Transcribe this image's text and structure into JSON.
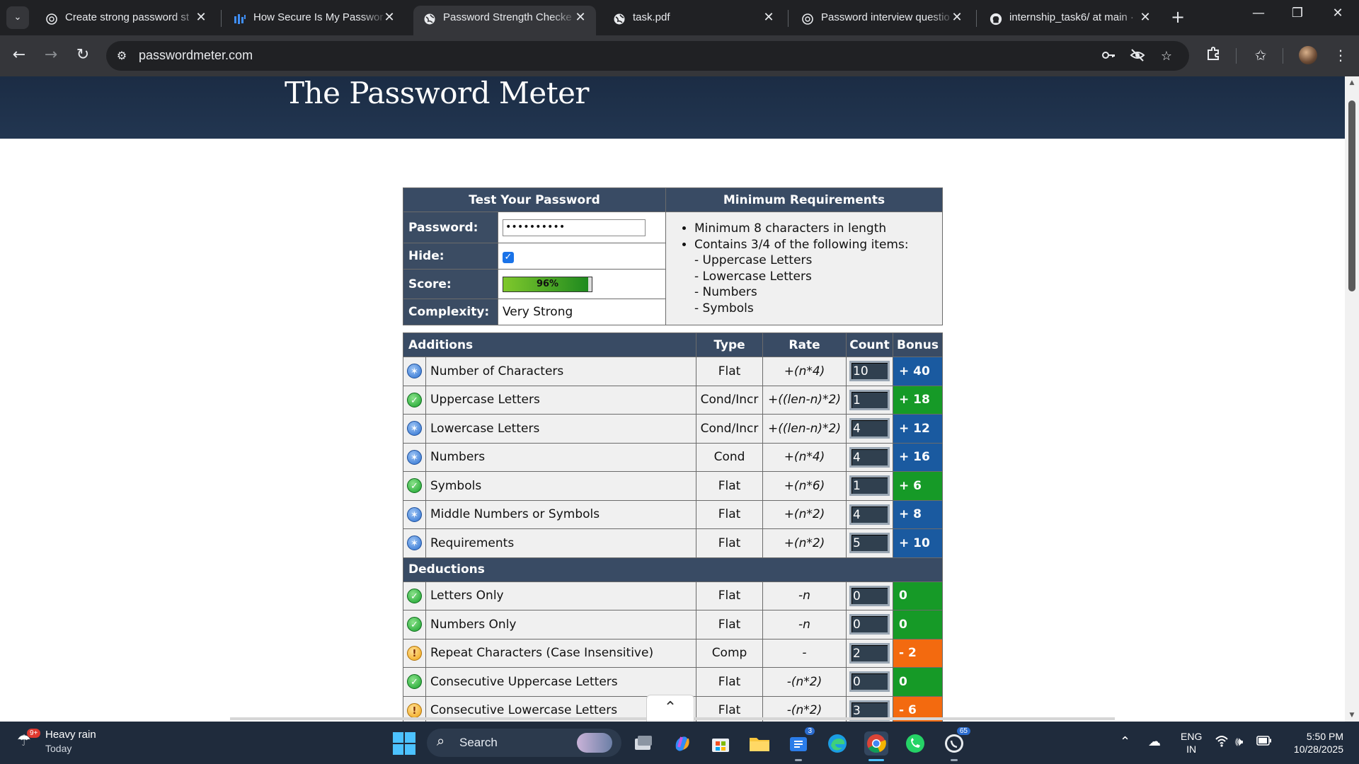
{
  "tabs": [
    {
      "title": "Create strong password st",
      "icon": "openai-icon"
    },
    {
      "title": "How Secure Is My Passwor",
      "icon": "security-org-icon"
    },
    {
      "title": "Password Strength Checke",
      "icon": "globe-icon",
      "active": true
    },
    {
      "title": "task.pdf",
      "icon": "globe-icon"
    },
    {
      "title": "Password interview questio",
      "icon": "openai-icon"
    },
    {
      "title": "internship_task6/ at main ·",
      "icon": "github-icon"
    }
  ],
  "address": {
    "url": "passwordmeter.com"
  },
  "site": {
    "title": "The Password Meter"
  },
  "meter": {
    "test_heading": "Test Your Password",
    "req_heading": "Minimum Requirements",
    "password_label": "Password:",
    "password_value": "••••••••••",
    "hide_label": "Hide:",
    "hide_checked": true,
    "score_label": "Score:",
    "score_value": "96%",
    "score_fraction": 0.96,
    "complexity_label": "Complexity:",
    "complexity_value": "Very Strong",
    "requirements": [
      "Minimum 8 characters in length",
      "Contains 3/4 of the following items:"
    ],
    "requirement_items": [
      "- Uppercase Letters",
      "- Lowercase Letters",
      "- Numbers",
      "- Symbols"
    ]
  },
  "table": {
    "headers": {
      "additions": "Additions",
      "type": "Type",
      "rate": "Rate",
      "count": "Count",
      "bonus": "Bonus",
      "deductions": "Deductions"
    },
    "additions": [
      {
        "name": "Number of Characters",
        "type": "Flat",
        "rate": "+(n*4)",
        "count": "10",
        "bonus": "+ 40",
        "status": "sufficient",
        "color": "blue"
      },
      {
        "name": "Uppercase Letters",
        "type": "Cond/Incr",
        "rate": "+((len-n)*2)",
        "count": "1",
        "bonus": "+ 18",
        "status": "good",
        "color": "green"
      },
      {
        "name": "Lowercase Letters",
        "type": "Cond/Incr",
        "rate": "+((len-n)*2)",
        "count": "4",
        "bonus": "+ 12",
        "status": "sufficient",
        "color": "blue"
      },
      {
        "name": "Numbers",
        "type": "Cond",
        "rate": "+(n*4)",
        "count": "4",
        "bonus": "+ 16",
        "status": "sufficient",
        "color": "blue"
      },
      {
        "name": "Symbols",
        "type": "Flat",
        "rate": "+(n*6)",
        "count": "1",
        "bonus": "+ 6",
        "status": "good",
        "color": "green"
      },
      {
        "name": "Middle Numbers or Symbols",
        "type": "Flat",
        "rate": "+(n*2)",
        "count": "4",
        "bonus": "+ 8",
        "status": "sufficient",
        "color": "blue"
      },
      {
        "name": "Requirements",
        "type": "Flat",
        "rate": "+(n*2)",
        "count": "5",
        "bonus": "+ 10",
        "status": "sufficient",
        "color": "blue"
      }
    ],
    "deductions": [
      {
        "name": "Letters Only",
        "type": "Flat",
        "rate": "-n",
        "count": "0",
        "bonus": "0",
        "status": "good",
        "color": "green"
      },
      {
        "name": "Numbers Only",
        "type": "Flat",
        "rate": "-n",
        "count": "0",
        "bonus": "0",
        "status": "good",
        "color": "green"
      },
      {
        "name": "Repeat Characters (Case Insensitive)",
        "type": "Comp",
        "rate": "-",
        "count": "2",
        "bonus": "- 2",
        "status": "warning",
        "color": "orange"
      },
      {
        "name": "Consecutive Uppercase Letters",
        "type": "Flat",
        "rate": "-(n*2)",
        "count": "0",
        "bonus": "0",
        "status": "good",
        "color": "green"
      },
      {
        "name": "Consecutive Lowercase Letters",
        "type": "Flat",
        "rate": "-(n*2)",
        "count": "3",
        "bonus": "- 6",
        "status": "warning",
        "color": "orange"
      }
    ]
  },
  "taskbar": {
    "weather_title": "Heavy rain",
    "weather_sub": "Today",
    "weather_badge": "9+",
    "search_label": "Search",
    "store_badge": "3",
    "whatsapp_badge": "65",
    "lang_top": "ENG",
    "lang_bottom": "IN",
    "time": "5:50 PM",
    "date": "10/28/2025"
  },
  "colors": {
    "header_bg": "#1b2c44",
    "table_header": "#394b64",
    "bonus_blue": "#1a5aa0",
    "bonus_green": "#169a27",
    "bonus_orange": "#f36a0f"
  }
}
